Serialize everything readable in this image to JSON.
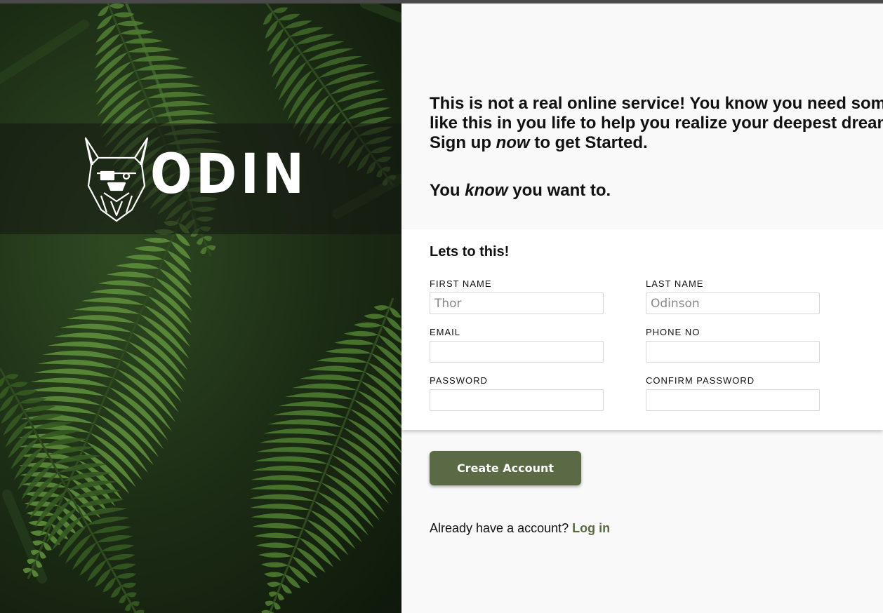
{
  "brand": {
    "name": "ODIN"
  },
  "intro": {
    "line1": "This is not a real online service! You know you need something",
    "line2": "like this in you life to help you realize your deepest dreams.",
    "line3_pre": "Sign up ",
    "line3_em": "now",
    "line3_post": " to get Started.",
    "tagline_pre": "You ",
    "tagline_em": "know",
    "tagline_post": " you want to."
  },
  "form": {
    "title": "Lets to this!",
    "first_name": {
      "label": "FIRST NAME",
      "placeholder": "Thor"
    },
    "last_name": {
      "label": "LAST NAME",
      "placeholder": "Odinson"
    },
    "email": {
      "label": "EMAIL",
      "placeholder": ""
    },
    "phone": {
      "label": "PHONE NO",
      "placeholder": ""
    },
    "password": {
      "label": "PASSWORD",
      "placeholder": ""
    },
    "confirm_password": {
      "label": "CONFIRM PASSWORD",
      "placeholder": ""
    }
  },
  "actions": {
    "create_label": "Create Account",
    "login_prompt": "Already have a account?",
    "login_link": "Log in"
  },
  "colors": {
    "accent": "#596a45",
    "panel": "#f9f9f9",
    "card": "#ffffff"
  },
  "icons": {
    "logo": "viking-dog-head-icon"
  }
}
